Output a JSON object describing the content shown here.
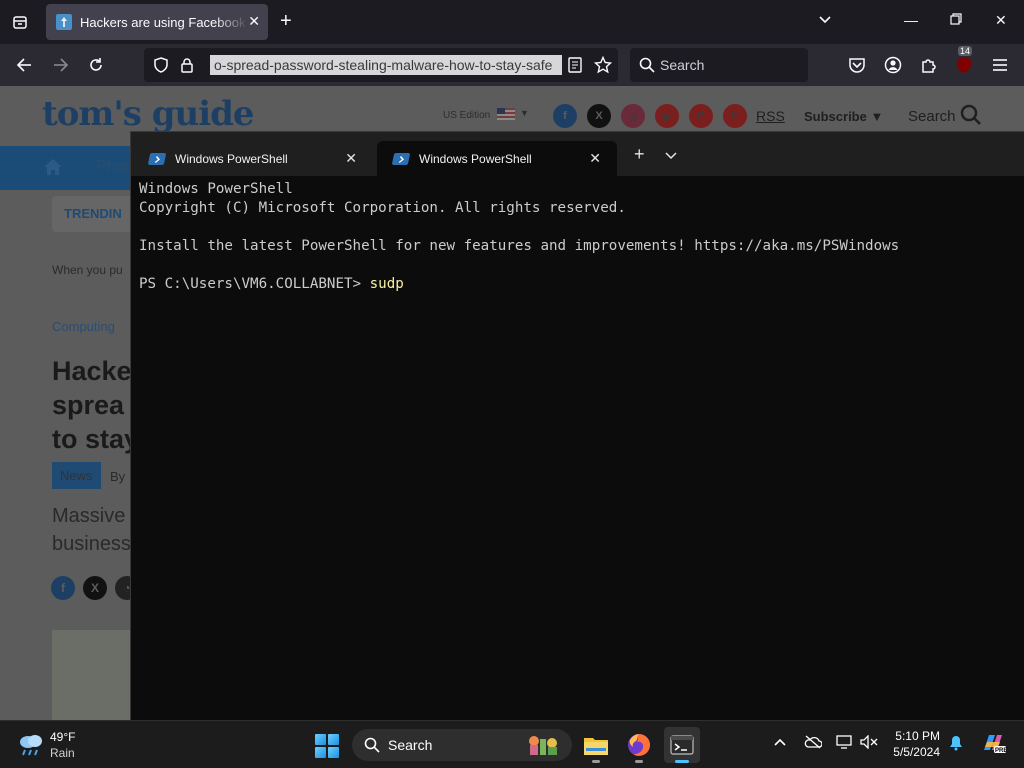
{
  "browser": {
    "tab_title": "Hackers are using Facebook Messenger",
    "url": "o-spread-password-stealing-malware-how-to-stay-safe",
    "search_placeholder": "Search",
    "extension_badge": "14"
  },
  "website": {
    "logo": "tom's guide",
    "edition": "US Edition",
    "rss": "RSS",
    "subscribe": "Subscribe ▼",
    "search": "Search",
    "nav_partial": "Phon",
    "trending": "TRENDIN",
    "intro_partial": "When you pu",
    "category": "Computing",
    "headline_lines": [
      "Hacke",
      "sprea",
      "to stay"
    ],
    "news_badge": "News",
    "byline_partial": "By",
    "subhead_lines": [
      "Massive",
      "business"
    ]
  },
  "terminal": {
    "tabs": [
      {
        "title": "Windows PowerShell",
        "active": false
      },
      {
        "title": "Windows PowerShell",
        "active": true
      }
    ],
    "line1": "Windows PowerShell",
    "line2": "Copyright (C) Microsoft Corporation. All rights reserved.",
    "line3": "Install the latest PowerShell for new features and improvements! https://aka.ms/PSWindows",
    "prompt": "PS C:\\Users\\VM6.COLLABNET> ",
    "command": "sudp"
  },
  "taskbar": {
    "temperature": "49°F",
    "condition": "Rain",
    "search_label": "Search",
    "time": "5:10 PM",
    "date": "5/5/2024"
  },
  "colors": {
    "terminal_bg": "#0c0c0c",
    "command_text": "#f9f1a5",
    "accent_blue": "#4cc2ff"
  }
}
